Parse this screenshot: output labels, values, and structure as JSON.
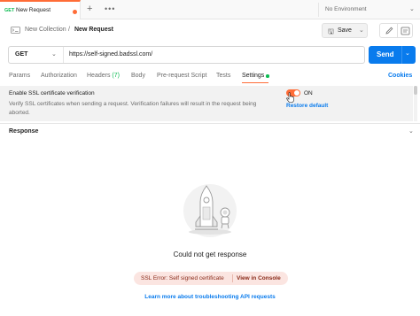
{
  "tabbar": {
    "tab": {
      "method": "GET",
      "name": "New Request"
    },
    "add_icon": "plus-icon",
    "more_icon": "more-horizontal-icon",
    "environment": "No Environment"
  },
  "header": {
    "collection_icon": "http-request-icon",
    "collection": "New Collection",
    "separator": "/",
    "request": "New Request",
    "save_label": "Save",
    "save_icon": "floppy-disk-icon",
    "edit_icon": "pencil-icon",
    "docs_icon": "documentation-icon"
  },
  "urlbar": {
    "method": "GET",
    "url": "https://self-signed.badssl.com/",
    "send_label": "Send"
  },
  "request_tabs": {
    "items": [
      {
        "label": "Params"
      },
      {
        "label": "Authorization"
      },
      {
        "label": "Headers",
        "count": "(7)"
      },
      {
        "label": "Body"
      },
      {
        "label": "Pre-request Script"
      },
      {
        "label": "Tests"
      },
      {
        "label": "Settings"
      }
    ],
    "active": "Settings",
    "cookies_label": "Cookies"
  },
  "settings": {
    "ssl_title": "Enable SSL certificate verification",
    "ssl_description": "Verify SSL certificates when sending a request. Verification failures will result in the request being aborted.",
    "toggle_state": "ON",
    "restore_label": "Restore default"
  },
  "response": {
    "title": "Response",
    "empty_message": "Could not get response",
    "error_text": "SSL Error: Self signed certificate",
    "console_link": "View in Console",
    "learn_link": "Learn more about troubleshooting API requests"
  },
  "colors": {
    "accent": "#ff6c37",
    "primary": "#097bed",
    "get_method": "#0cbb52",
    "error_bg": "#fbe5e1"
  }
}
